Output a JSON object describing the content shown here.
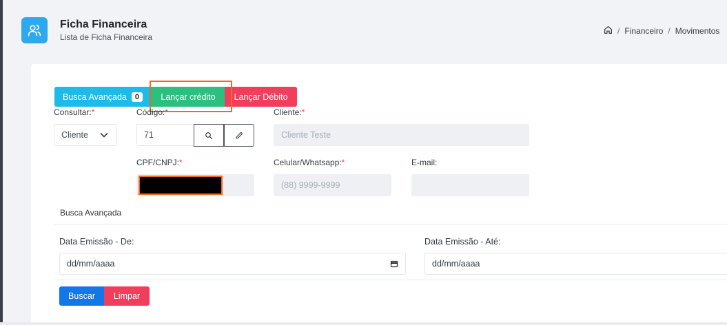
{
  "header": {
    "title": "Ficha Financeira",
    "subtitle": "Lista de Ficha Financeira",
    "icon": "users-icon"
  },
  "breadcrumb": {
    "items": [
      "Financeiro",
      "Movimentos"
    ],
    "separator": "/"
  },
  "toolbar": {
    "busca_label": "Busca Avançada",
    "busca_count": "0",
    "credito_label": "Lançar crédito",
    "debito_label": "Lançar Débito"
  },
  "form": {
    "consultar_label": "Consultar:",
    "consultar_value": "Cliente",
    "codigo_label": "Código:",
    "codigo_value": "71",
    "cliente_label": "Cliente:",
    "cliente_placeholder": "Cliente Teste",
    "cpf_label": "CPF/CNPJ:",
    "celular_label": "Celular/Whatsapp:",
    "celular_placeholder": "(88) 9999-9999",
    "email_label": "E-mail:",
    "required_mark": "*"
  },
  "advanced": {
    "title": "Busca Avançada",
    "data_de_label": "Data Emissão - De:",
    "data_de_value": "dd/mm/aaaa",
    "data_ate_label": "Data Emissão - Até:",
    "data_ate_value": "dd/mm/aaaa",
    "buscar_label": "Buscar",
    "limpar_label": "Limpar"
  },
  "colors": {
    "accent": "#2ea8ee",
    "busca": "#1cbbe8",
    "credito": "#2bbf80",
    "debito": "#f23d5c",
    "buscar": "#1277e8",
    "highlight": "#f26b1d"
  }
}
